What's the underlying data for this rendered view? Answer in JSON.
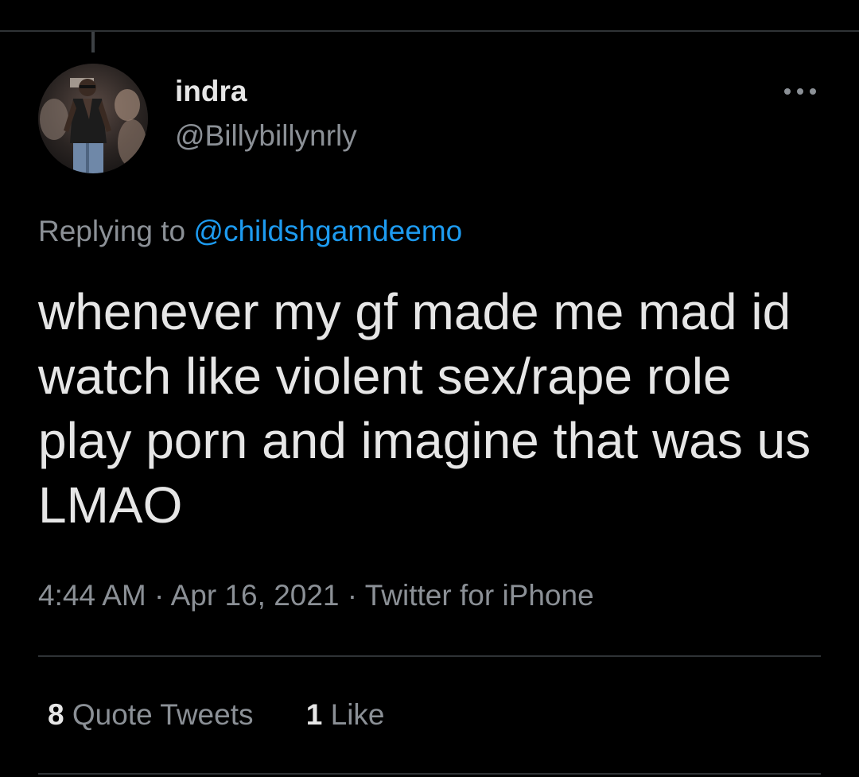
{
  "author": {
    "display_name": "indra",
    "handle": "@Billybillynrly"
  },
  "reply": {
    "prefix": "Replying to",
    "mention": "@childshgamdeemo"
  },
  "tweet": {
    "text": "whenever my gf made me mad id watch like violent sex/rape role play porn and imagine that was us LMAO"
  },
  "meta": {
    "time": "4:44 AM",
    "separator": "·",
    "date": "Apr 16, 2021",
    "source": "Twitter for iPhone"
  },
  "stats": {
    "quote_tweets_count": "8",
    "quote_tweets_label": "Quote Tweets",
    "likes_count": "1",
    "likes_label": "Like"
  },
  "icons": {
    "more": "more-horizontal-icon"
  },
  "colors": {
    "background": "#000000",
    "primary_text": "#e6e6e6",
    "secondary_text": "#8b9096",
    "link": "#1d9bf0",
    "divider": "#2f3336"
  }
}
